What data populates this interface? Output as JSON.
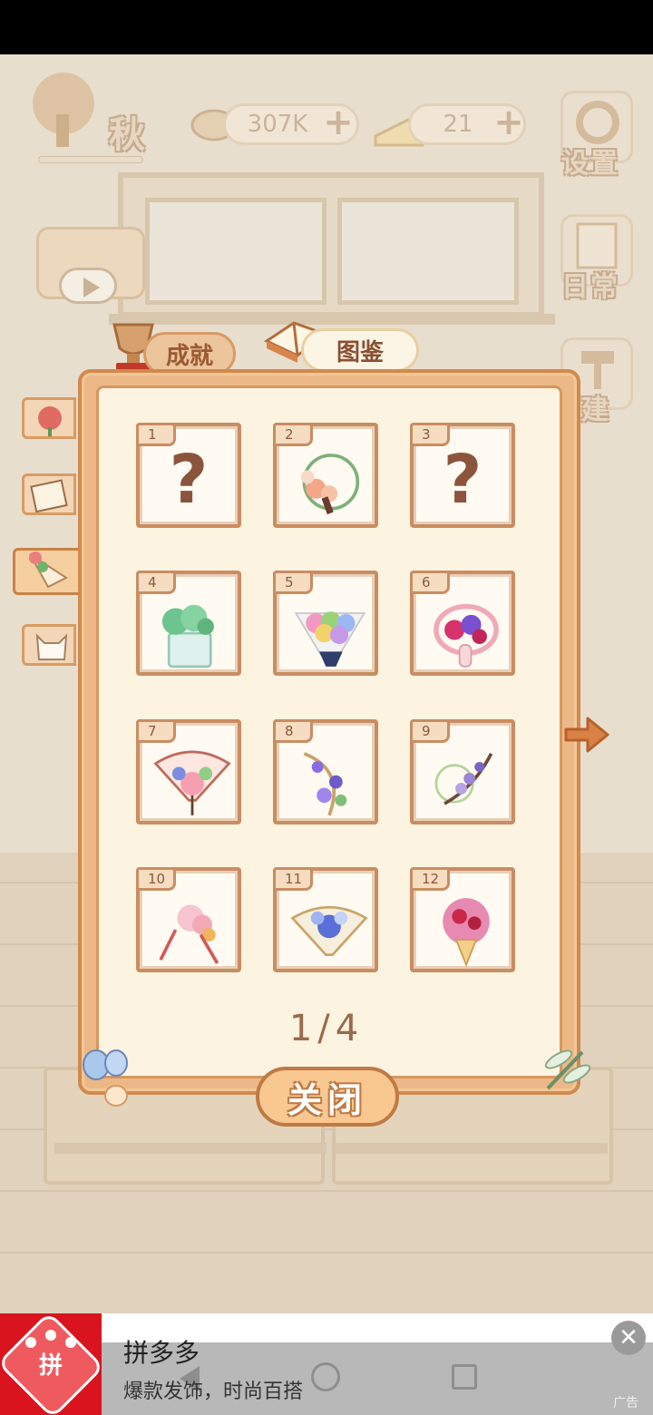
{
  "hud": {
    "season": "秋",
    "fish_count": "307K",
    "cheese_count": "21",
    "settings_label": "设置",
    "daily_label": "日常",
    "build_label": "建"
  },
  "tabs": {
    "achievements": "成就",
    "atlas": "图鉴"
  },
  "collection": {
    "items": [
      {
        "number": "1",
        "unlocked": false,
        "placeholder": "?",
        "icon": "question-mark"
      },
      {
        "number": "2",
        "unlocked": true,
        "icon": "peach-flower-wreath"
      },
      {
        "number": "3",
        "unlocked": false,
        "placeholder": "?",
        "icon": "question-mark"
      },
      {
        "number": "4",
        "unlocked": true,
        "icon": "green-hydrangea-vase"
      },
      {
        "number": "5",
        "unlocked": true,
        "icon": "rainbow-bouquet"
      },
      {
        "number": "6",
        "unlocked": true,
        "icon": "pink-flower-basket"
      },
      {
        "number": "7",
        "unlocked": true,
        "icon": "floral-fan"
      },
      {
        "number": "8",
        "unlocked": true,
        "icon": "purple-berry-hoop"
      },
      {
        "number": "9",
        "unlocked": true,
        "icon": "wisteria-branch"
      },
      {
        "number": "10",
        "unlocked": true,
        "icon": "pink-hairpin"
      },
      {
        "number": "11",
        "unlocked": true,
        "icon": "blue-fan-bouquet"
      },
      {
        "number": "12",
        "unlocked": true,
        "icon": "rose-ice-cream"
      }
    ],
    "page": "1/4",
    "close_label": "关闭"
  },
  "ad": {
    "title": "拼多多",
    "description": "爆款发饰，时尚百搭",
    "tag": "广告",
    "close_symbol": "✕",
    "logo_text": "拼"
  },
  "colors": {
    "panel": "#ecb887",
    "panel_inner": "#fcf4e1",
    "card_border": "#c98d62",
    "accent": "#d2894e"
  }
}
